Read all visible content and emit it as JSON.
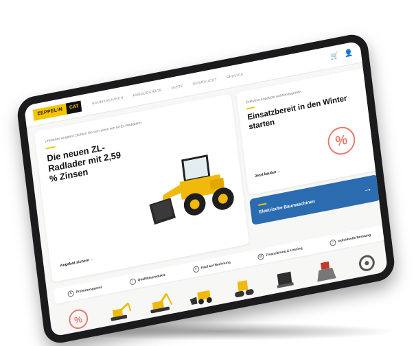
{
  "header": {
    "logo_primary": "ZEPPELIN",
    "logo_secondary": "CAT",
    "nav": [
      "BAUMASCHINEN",
      "ANBAUGERÄTE",
      "MIETE",
      "GEBRAUCHT",
      "SERVICE"
    ],
    "cart_icon": "cart-icon",
    "user_icon": "user-icon"
  },
  "hero": {
    "eyebrow": "Limitiertes Angebot: Sichern Sie sich einen von 50 ZL-Radladern",
    "title": "Die neuen ZL-Radlader mit 2,59 % Zinsen",
    "link": "Angebot sichern →"
  },
  "promo": {
    "eyebrow": "Exklusive Angebote auf Anbaugeräte",
    "title": "Einsatzbereit in den Winter starten",
    "link": "Jetzt kaufen →",
    "badge": "%"
  },
  "electric": {
    "label": "Elektrische Baumaschinen",
    "arrow": "→"
  },
  "features": [
    {
      "icon": "price-icon",
      "label": "Preistransparenz"
    },
    {
      "icon": "quality-icon",
      "label": "Qualitätsprodukte"
    },
    {
      "icon": "invoice-icon",
      "label": "Kauf auf Rechnung"
    },
    {
      "icon": "finance-icon",
      "label": "Finanzierung & Leasing"
    },
    {
      "icon": "advice-icon",
      "label": "Individuelle Beratung"
    }
  ],
  "categories": [
    {
      "name": "sale",
      "badge": "%"
    },
    {
      "name": "mini-excavator"
    },
    {
      "name": "excavator"
    },
    {
      "name": "wheel-loader"
    },
    {
      "name": "roller"
    },
    {
      "name": "attachment"
    },
    {
      "name": "grapple"
    },
    {
      "name": "more"
    }
  ],
  "colors": {
    "brand_yellow": "#f5c400",
    "dark": "#111111",
    "electric_blue": "#2b6cb0",
    "sale_red": "#e8796c"
  }
}
